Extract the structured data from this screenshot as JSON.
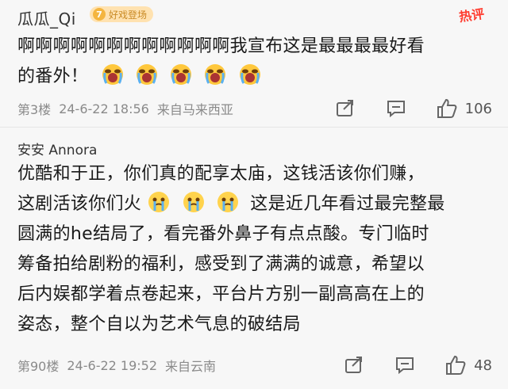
{
  "comments": [
    {
      "username": "瓜瓜_Qi",
      "badge_level": "7",
      "badge_text": "好戏登场",
      "hot_tag": "热评",
      "text_1": "啊啊啊啊啊啊啊啊啊啊啊啊我宣布这是最最最最好看",
      "text_2": "的番外！",
      "emoji_count": 5,
      "floor": "第3楼",
      "date": "24-6-22 18:56",
      "location": "来自马来西亚",
      "likes": "106"
    },
    {
      "username": "安安 Annora",
      "text_1": "优酷和于正，你们真的配享太庙，这钱活该你们赚，",
      "text_2a": "这剧活该你们火",
      "text_2b": "这是近几年看过最完整最",
      "text_3": "圆满的he结局了，看完番外鼻子有点点酸。专门临时",
      "text_4": "筹备拍给剧粉的福利，感受到了满满的诚意，希望以",
      "text_5": "后内娱都学着点卷起来，平台片方别一副高高在上的",
      "text_6": "姿态，整个自以为艺术气息的破结局",
      "emoji_count": 3,
      "floor": "第90楼",
      "date": "24-6-22 19:52",
      "location": "来自云南",
      "likes": "48"
    }
  ],
  "colors": {
    "background": "#f7f7f7",
    "hot_tag": "#ff3c2f",
    "meta_gray": "#8a8a8a",
    "badge_bg": "#ffe2b0"
  }
}
